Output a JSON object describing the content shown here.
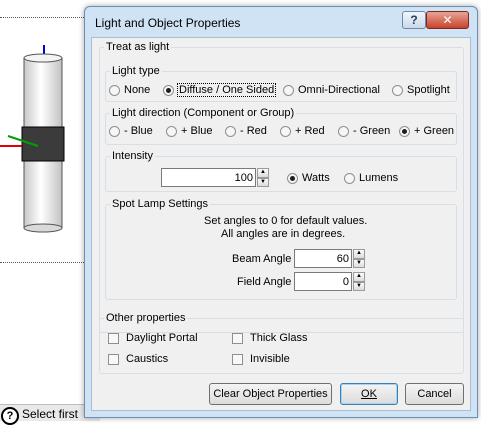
{
  "window": {
    "title": "Light and Object Properties",
    "help_glyph": "?",
    "close_glyph": "✕"
  },
  "status_bar": {
    "help_glyph": "?",
    "text": "Select first"
  },
  "treat_as_light": {
    "label": "Treat as light",
    "light_type": {
      "label": "Light type",
      "options": [
        "None",
        "Diffuse / One Sided",
        "Omni-Directional",
        "Spotlight"
      ],
      "selected": "Diffuse / One Sided"
    },
    "light_direction": {
      "label": "Light direction (Component or Group)",
      "options": [
        "- Blue",
        "+ Blue",
        "- Red",
        "+ Red",
        "- Green",
        "+ Green"
      ],
      "selected": "+ Green"
    },
    "intensity": {
      "label": "Intensity",
      "value": "100",
      "units": [
        "Watts",
        "Lumens"
      ],
      "selected_unit": "Watts"
    },
    "spot_lamp": {
      "label": "Spot Lamp Settings",
      "note_line1": "Set angles to 0 for default values.",
      "note_line2": "All angles are in degrees.",
      "beam_angle_label": "Beam Angle",
      "beam_angle_value": "60",
      "field_angle_label": "Field Angle",
      "field_angle_value": "0"
    },
    "other_properties": {
      "label": "Other properties",
      "daylight_portal": "Daylight Portal",
      "thick_glass": "Thick Glass",
      "caustics": "Caustics",
      "invisible": "Invisible"
    }
  },
  "buttons": {
    "clear": "Clear Object Properties",
    "ok": "OK",
    "cancel": "Cancel"
  },
  "colors": {
    "title_bar": "#cfe3f5",
    "client_bg": "#f0f0f0",
    "close_red": "#c7432c",
    "group_border": "#d5dfe5"
  }
}
